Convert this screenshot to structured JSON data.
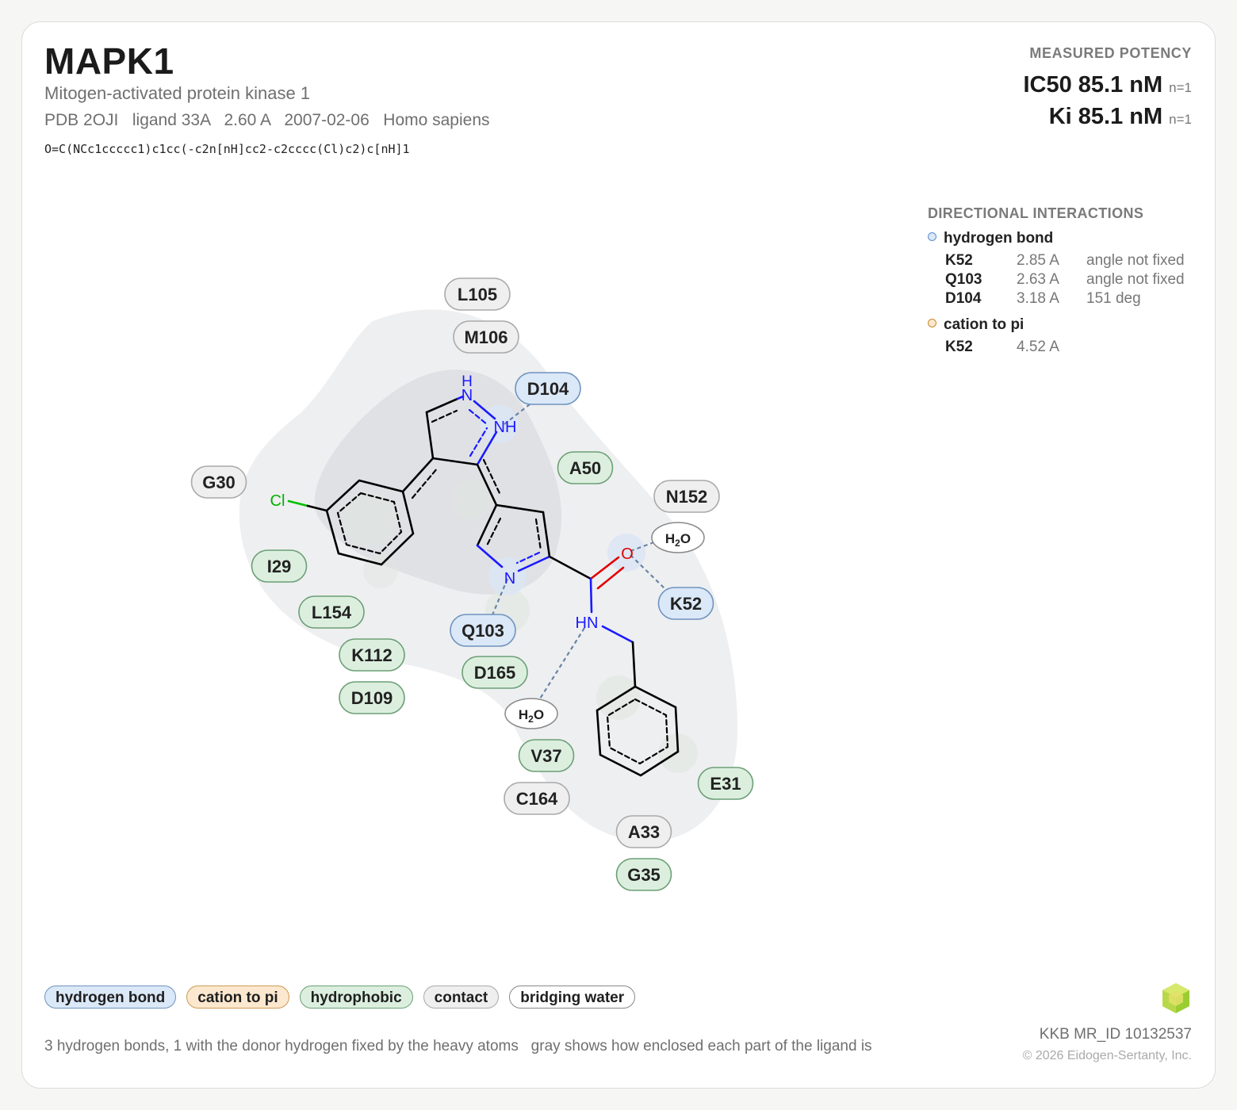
{
  "header": {
    "title": "MAPK1",
    "subtitle": "Mitogen-activated protein kinase 1",
    "meta": "PDB 2OJI   ligand 33A   2.60 A   2007-02-06   Homo sapiens",
    "smiles": "O=C(NCc1ccccc1)c1cc(-c2n[nH]cc2-c2cccc(Cl)c2)c[nH]1"
  },
  "potency": {
    "label": "MEASURED POTENCY",
    "rows": [
      {
        "text": "IC50 85.1 nM",
        "n": "n=1"
      },
      {
        "text": "Ki 85.1 nM",
        "n": "n=1"
      }
    ]
  },
  "interactions": {
    "heading": "DIRECTIONAL INTERACTIONS",
    "groups": [
      {
        "type": "hydrogen bond",
        "color": "#5b8fcf",
        "rows": [
          {
            "res": "K52",
            "dist": "2.85 A",
            "angle": "angle not fixed"
          },
          {
            "res": "Q103",
            "dist": "2.63 A",
            "angle": "angle not fixed"
          },
          {
            "res": "D104",
            "dist": "3.18 A",
            "angle": "151 deg"
          }
        ]
      },
      {
        "type": "cation to pi",
        "color": "#c98a2e",
        "rows": [
          {
            "res": "K52",
            "dist": "4.52 A",
            "angle": ""
          }
        ]
      }
    ]
  },
  "diagram": {
    "atoms": {
      "cl": "Cl",
      "h": "H",
      "n": "N",
      "nh": "NH",
      "hn": "HN",
      "o": "O"
    },
    "water_label": "H2O",
    "residues": [
      {
        "id": "L105",
        "kind": "contact"
      },
      {
        "id": "M106",
        "kind": "contact"
      },
      {
        "id": "D104",
        "kind": "hbond"
      },
      {
        "id": "A50",
        "kind": "hydrophobic"
      },
      {
        "id": "G30",
        "kind": "contact"
      },
      {
        "id": "N152",
        "kind": "contact"
      },
      {
        "id": "I29",
        "kind": "hydrophobic"
      },
      {
        "id": "K52",
        "kind": "hbond"
      },
      {
        "id": "L154",
        "kind": "hydrophobic"
      },
      {
        "id": "Q103",
        "kind": "hbond"
      },
      {
        "id": "K112",
        "kind": "hydrophobic"
      },
      {
        "id": "D165",
        "kind": "hydrophobic"
      },
      {
        "id": "D109",
        "kind": "hydrophobic"
      },
      {
        "id": "V37",
        "kind": "hydrophobic"
      },
      {
        "id": "E31",
        "kind": "hydrophobic"
      },
      {
        "id": "C164",
        "kind": "contact"
      },
      {
        "id": "A33",
        "kind": "contact"
      },
      {
        "id": "G35",
        "kind": "hydrophobic"
      }
    ]
  },
  "legend": [
    "hydrogen bond",
    "cation to pi",
    "hydrophobic",
    "contact",
    "bridging water"
  ],
  "footnote": "3 hydrogen bonds, 1 with the donor hydrogen fixed by the heavy atoms   gray shows how enclosed each part of the ligand is",
  "footer": {
    "id": "KKB MR_ID 10132537",
    "copyright": "© 2026 Eidogen-Sertanty, Inc."
  }
}
